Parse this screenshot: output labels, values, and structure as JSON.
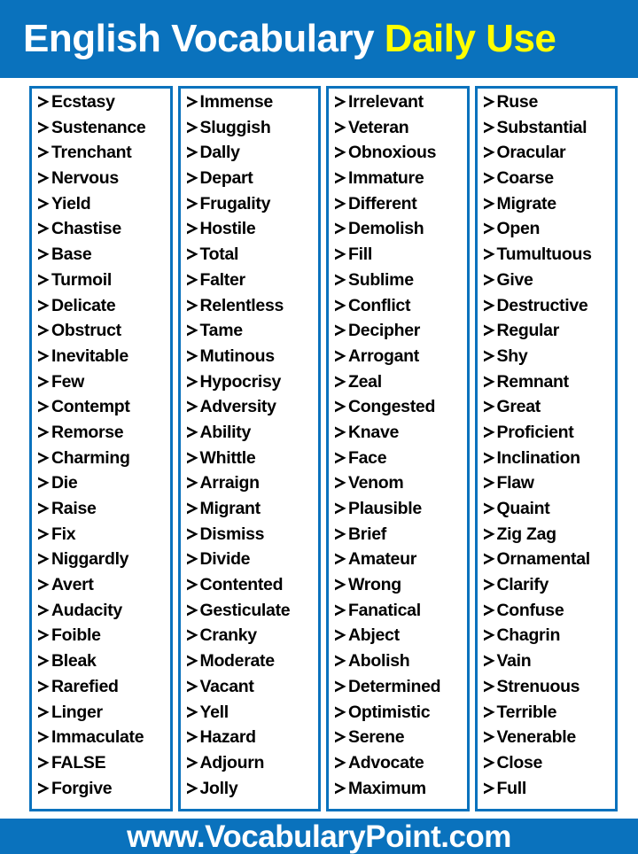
{
  "header": {
    "title_part1": "English Vocabulary ",
    "title_part2": "Daily Use",
    "background_color": "#0a72bd",
    "part1_color": "#ffffff",
    "part2_color": "#ffff00"
  },
  "footer": {
    "website": "www.VocabularyPoint.com",
    "background_color": "#0a72bd",
    "text_color": "#ffffff"
  },
  "table": {
    "border_color": "#0a72bd",
    "bullet_icon": "arrow-bullet-icon",
    "column_count": 4,
    "rows_per_column": 29,
    "total_words": 116,
    "columns": [
      {
        "index": 1,
        "words": [
          "Ecstasy",
          "Sustenance",
          "Trenchant",
          "Nervous",
          "Yield",
          "Chastise",
          "Base",
          "Turmoil",
          "Delicate",
          "Obstruct",
          "Inevitable",
          "Few",
          "Contempt",
          "Remorse",
          "Charming",
          "Die",
          "Raise",
          "Fix",
          "Niggardly",
          "Avert",
          "Audacity",
          "Foible",
          "Bleak",
          "Rarefied",
          "Linger",
          "Immaculate",
          "FALSE",
          "Forgive"
        ]
      },
      {
        "index": 2,
        "words": [
          "Immense",
          "Sluggish",
          "Dally",
          "Depart",
          "Frugality",
          "Hostile",
          "Total",
          "Falter",
          "Relentless",
          "Tame",
          "Mutinous",
          "Hypocrisy",
          "Adversity",
          "Ability",
          "Whittle",
          "Arraign",
          "Migrant",
          "Dismiss",
          "Divide",
          "Contented",
          "Gesticulate",
          "Cranky",
          "Moderate",
          "Vacant",
          "Yell",
          "Hazard",
          "Adjourn",
          "Jolly"
        ]
      },
      {
        "index": 3,
        "words": [
          "Irrelevant",
          "Veteran",
          "Obnoxious",
          "Immature",
          "Different",
          "Demolish",
          "Fill",
          "Sublime",
          "Conflict",
          "Decipher",
          "Arrogant",
          "Zeal",
          "Congested",
          "Knave",
          "Face",
          "Venom",
          "Plausible",
          "Brief",
          "Amateur",
          "Wrong",
          "Fanatical",
          "Abject",
          "Abolish",
          "Determined",
          "Optimistic",
          "Serene",
          "Advocate",
          "Maximum"
        ]
      },
      {
        "index": 4,
        "words": [
          "Ruse",
          "Substantial",
          "Oracular",
          "Coarse",
          "Migrate",
          "Open",
          "Tumultuous",
          "Give",
          "Destructive",
          "Regular",
          "Shy",
          "Remnant",
          "Great",
          "Proficient",
          "Inclination",
          "Flaw",
          "Quaint",
          "Zig Zag",
          "Ornamental",
          "Clarify",
          "Confuse",
          "Chagrin",
          "Vain",
          "Strenuous",
          "Terrible",
          "Venerable",
          "Close",
          "Full"
        ]
      }
    ]
  }
}
